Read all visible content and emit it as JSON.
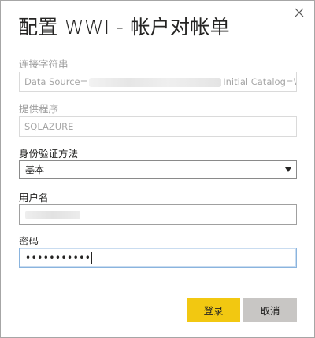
{
  "dialog": {
    "title": "配置 WWI - 帐户对帐单",
    "close_icon": "close-icon"
  },
  "connection_string": {
    "label": "连接字符串",
    "value_prefix": "Data Source=",
    "value_suffix": "Initial Catalog=Wic"
  },
  "provider": {
    "label": "提供程序",
    "value": "SQLAZURE"
  },
  "auth_method": {
    "label": "身份验证方法",
    "selected": "基本"
  },
  "username": {
    "label": "用户名"
  },
  "password": {
    "label": "密码",
    "masked_value": "•••••••••••"
  },
  "buttons": {
    "login": "登录",
    "cancel": "取消"
  },
  "colors": {
    "primary_button": "#f2c811",
    "secondary_button": "#c8c6c4",
    "focus_border": "#8ab4de"
  }
}
